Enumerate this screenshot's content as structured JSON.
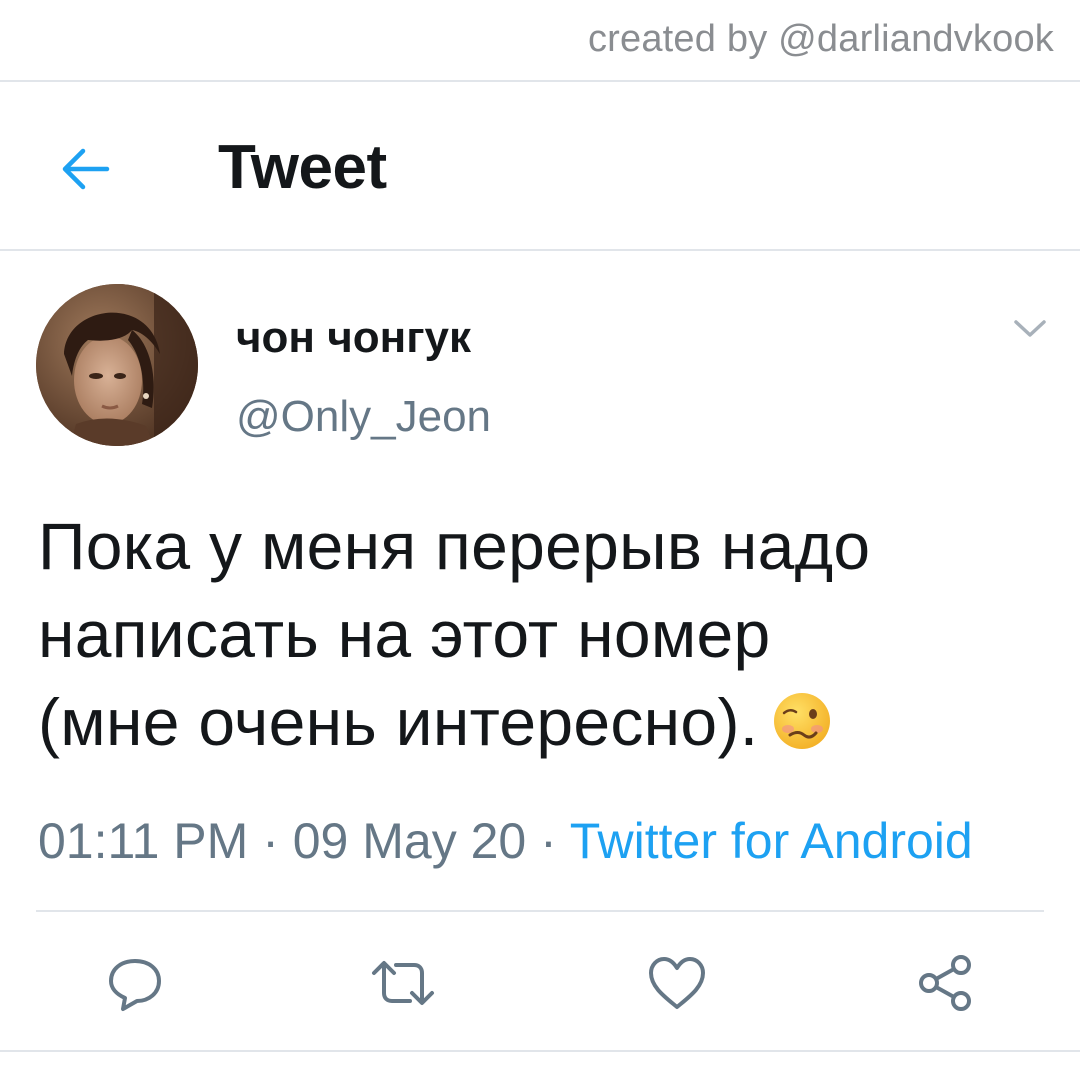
{
  "watermark": "created by @darliandvkook",
  "header": {
    "title": "Tweet",
    "back_icon": "arrow-left-icon"
  },
  "colors": {
    "accent": "#1da1f2",
    "secondary_text": "#657786",
    "primary_text": "#14171a",
    "divider": "#e1e5ea"
  },
  "tweet": {
    "display_name": "чон чонгук",
    "handle": "@Only_Jeon",
    "text_lines": [
      "Пока у меня перерыв надо",
      "написать на этот номер",
      "(мне очень интересно)."
    ],
    "emoji": "woozy-face-emoji",
    "time": "01:11 PM",
    "separator": " · ",
    "date": "09 May 20",
    "source": "Twitter for Android"
  },
  "actions": [
    {
      "icon": "reply-icon"
    },
    {
      "icon": "retweet-icon"
    },
    {
      "icon": "like-icon"
    },
    {
      "icon": "share-icon"
    }
  ]
}
